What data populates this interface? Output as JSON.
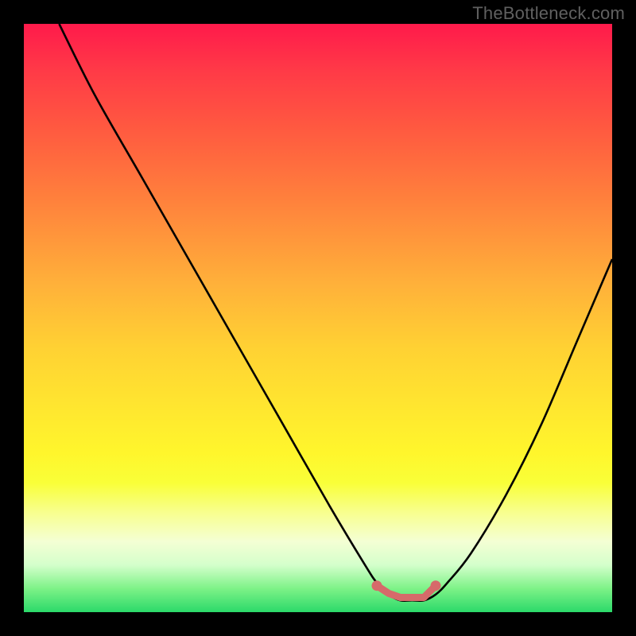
{
  "watermark": "TheBottleneck.com",
  "chart_data": {
    "type": "line",
    "title": "",
    "xlabel": "",
    "ylabel": "",
    "xlim": [
      0,
      100
    ],
    "ylim": [
      0,
      100
    ],
    "grid": false,
    "legend": false,
    "background_gradient_meaning": "bottleneck severity (green low to red high)",
    "series": [
      {
        "name": "bottleneck-curve",
        "color": "#000000",
        "x": [
          6,
          12,
          20,
          28,
          36,
          44,
          52,
          58,
          60,
          62,
          64,
          66,
          68,
          70,
          72,
          76,
          82,
          88,
          94,
          100
        ],
        "y": [
          100,
          88,
          74,
          60,
          46,
          32,
          18,
          8,
          5,
          3,
          2,
          2,
          2,
          3,
          5,
          10,
          20,
          32,
          46,
          60
        ]
      },
      {
        "name": "optimal-range-marker",
        "color": "#d66a6a",
        "x": [
          60,
          62,
          64,
          66,
          68,
          70
        ],
        "y": [
          4.5,
          3.2,
          2.5,
          2.5,
          2.5,
          4.5
        ]
      }
    ],
    "annotations": []
  }
}
